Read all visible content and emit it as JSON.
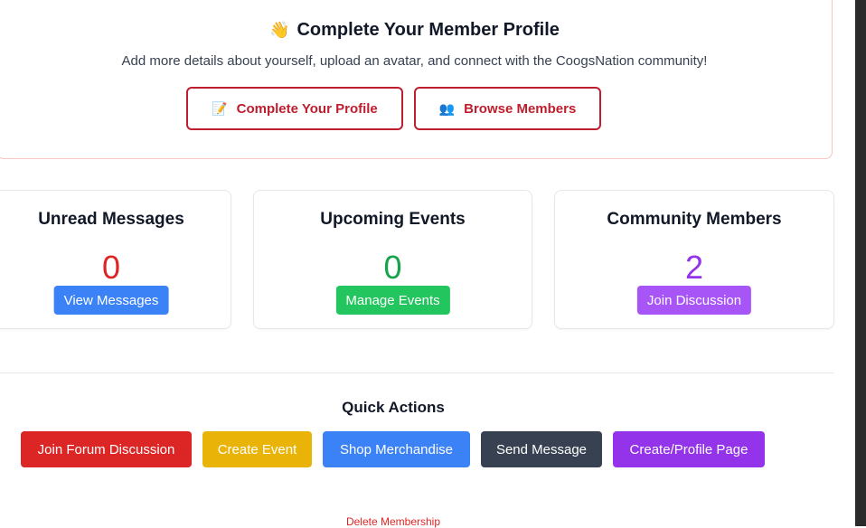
{
  "profile_banner": {
    "icon": "waving-hand-icon",
    "emoji": "👋",
    "title": "Complete Your Member Profile",
    "subtitle": "Add more details about yourself, upload an avatar, and connect with the CoogsNation community!",
    "buttons": [
      {
        "label": "Complete Your Profile",
        "icon": "memo-icon",
        "glyph": "📝"
      },
      {
        "label": "Browse Members",
        "icon": "members-icon",
        "glyph": "👥"
      }
    ],
    "accent_color": "#be1e2d"
  },
  "stats": [
    {
      "title": "Unread Messages",
      "value": "0",
      "value_color": "#dc2626",
      "button_label": "View Messages",
      "button_color": "#3b82f6"
    },
    {
      "title": "Upcoming Events",
      "value": "0",
      "value_color": "#16a34a",
      "button_label": "Manage Events",
      "button_color": "#22c55e"
    },
    {
      "title": "Community Members",
      "value": "2",
      "value_color": "#9333ea",
      "button_label": "Join Discussion",
      "button_color": "#a855f7"
    }
  ],
  "quick_actions": {
    "title": "Quick Actions",
    "buttons": [
      {
        "label": "Join Forum Discussion",
        "color": "#dc2626"
      },
      {
        "label": "Create Event",
        "color": "#eab308"
      },
      {
        "label": "Shop Merchandise",
        "color": "#3b82f6"
      },
      {
        "label": "Send Message",
        "color": "#374151"
      },
      {
        "label": "Create/Profile Page",
        "color": "#9333ea"
      }
    ]
  },
  "delete_link": {
    "label": "Delete Membership",
    "color": "#dc2626"
  }
}
